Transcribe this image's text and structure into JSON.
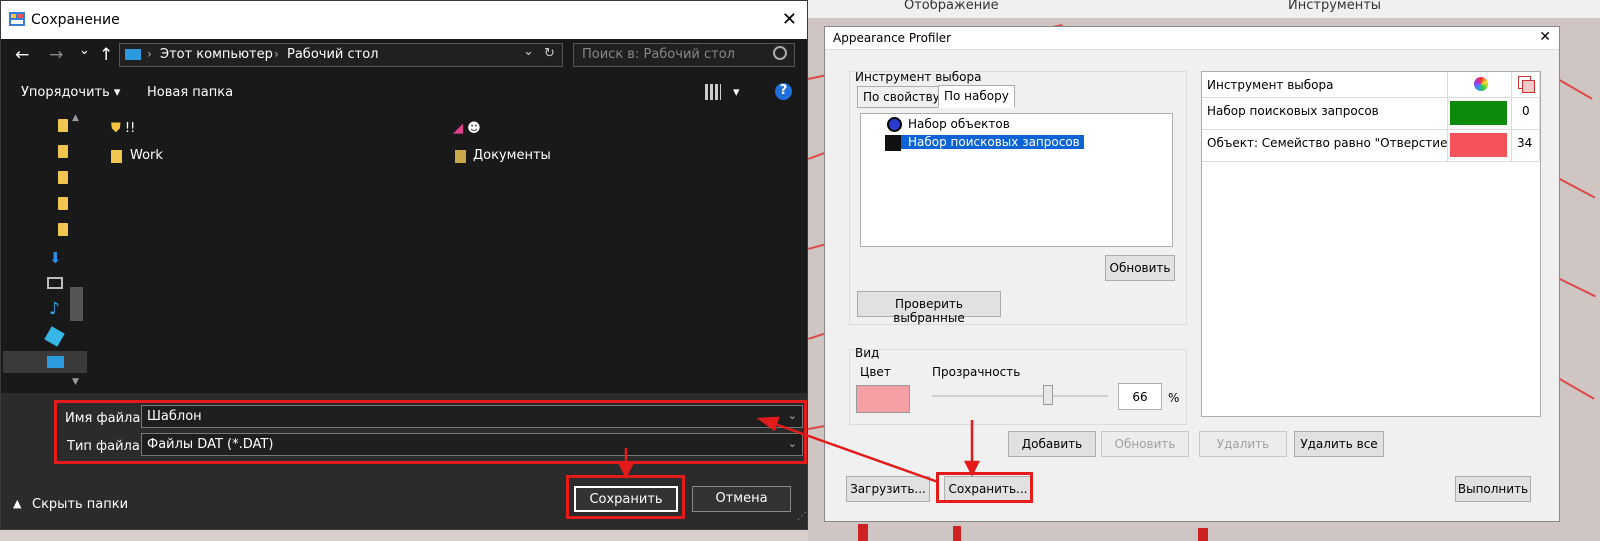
{
  "background": {
    "menu_display": "Отображение",
    "menu_tools": "Инструменты"
  },
  "save_dialog": {
    "title": "Сохранение",
    "close_glyph": "✕",
    "nav": {
      "back": "←",
      "forward": "→",
      "history": "⌄",
      "up": "↑"
    },
    "address": {
      "computer": "Этот компьютер",
      "desktop": "Рабочий стол",
      "refresh": "↻",
      "dropdown": "⌄"
    },
    "search_placeholder": "Поиск в: Рабочий стол",
    "toolbar": {
      "organize": "Упорядочить ▾",
      "new_folder": "Новая папка",
      "view_menu": "▾",
      "help": "?"
    },
    "files": [
      {
        "name": "!!",
        "icon": "shield-icon"
      },
      {
        "name": "☻",
        "icon": "app-shortcut-icon"
      },
      {
        "name": "Work",
        "icon": "folder-icon"
      },
      {
        "name": "Документы",
        "icon": "documents-folder-icon"
      }
    ],
    "filename_label": "Имя файла:",
    "filename_value": "Шаблон",
    "filetype_label": "Тип файла:",
    "filetype_value": "Файлы DAT (*.DAT)",
    "hide_folders": "Скрыть папки",
    "save_button": "Сохранить",
    "cancel_button": "Отмена",
    "accent_color": "#e31b1b"
  },
  "profiler": {
    "title": "Appearance Profiler",
    "close_glyph": "✕",
    "selection_group": "Инструмент выбора",
    "tab_by_property": "По свойству",
    "tab_by_set": "По набору",
    "tree_items": [
      "Набор объектов",
      "Набор поисковых запросов"
    ],
    "refresh_button": "Обновить",
    "check_selected_button": "Проверить выбранные",
    "view_group": "Вид",
    "color_label": "Цвет",
    "transparency_label": "Прозрачность",
    "transparency_value": "66",
    "transparency_fraction": 0.66,
    "percent_sign": "%",
    "grid_header": "Инструмент выбора",
    "grid_rows": [
      {
        "name": "Набор поисковых запросов",
        "color": "#0c8a0c",
        "count": "0"
      },
      {
        "name": "Объект: Семейство равно \"Отверстие_Ш...",
        "color": "#f4535a",
        "count": "34"
      }
    ],
    "add_button": "Добавить",
    "update_button": "Обновить",
    "delete_button": "Удалить",
    "delete_all_button": "Удалить все",
    "load_button": "Загрузить...",
    "save_button": "Сохранить...",
    "run_button": "Выполнить",
    "swatch_color": "#f4a0a4"
  }
}
